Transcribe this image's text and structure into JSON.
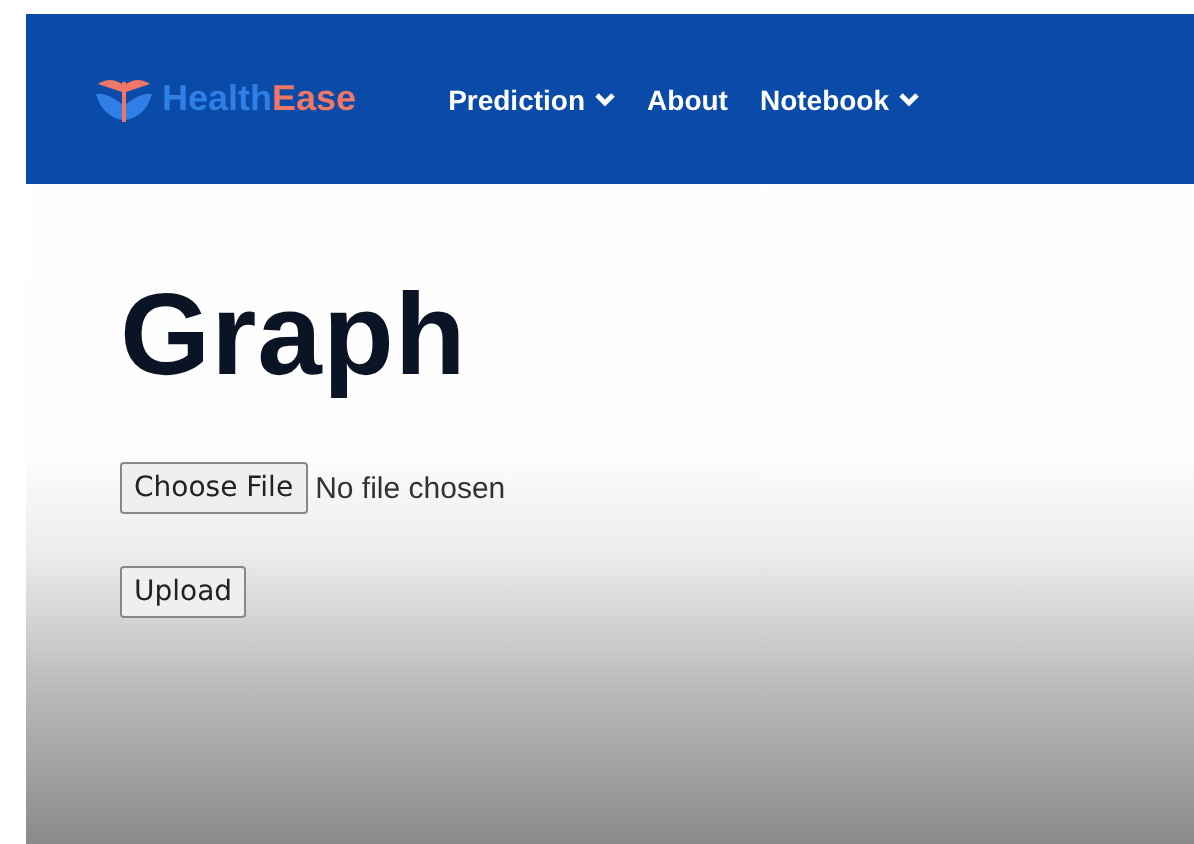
{
  "brand": {
    "parts": [
      "Health",
      "Ease"
    ]
  },
  "nav": [
    {
      "label": "Prediction",
      "dropdown": true
    },
    {
      "label": "About",
      "dropdown": false
    },
    {
      "label": "Notebook",
      "dropdown": true
    }
  ],
  "heading": "Graph",
  "file_input": {
    "button": "Choose File",
    "status": "No file chosen"
  },
  "upload_button": "Upload"
}
